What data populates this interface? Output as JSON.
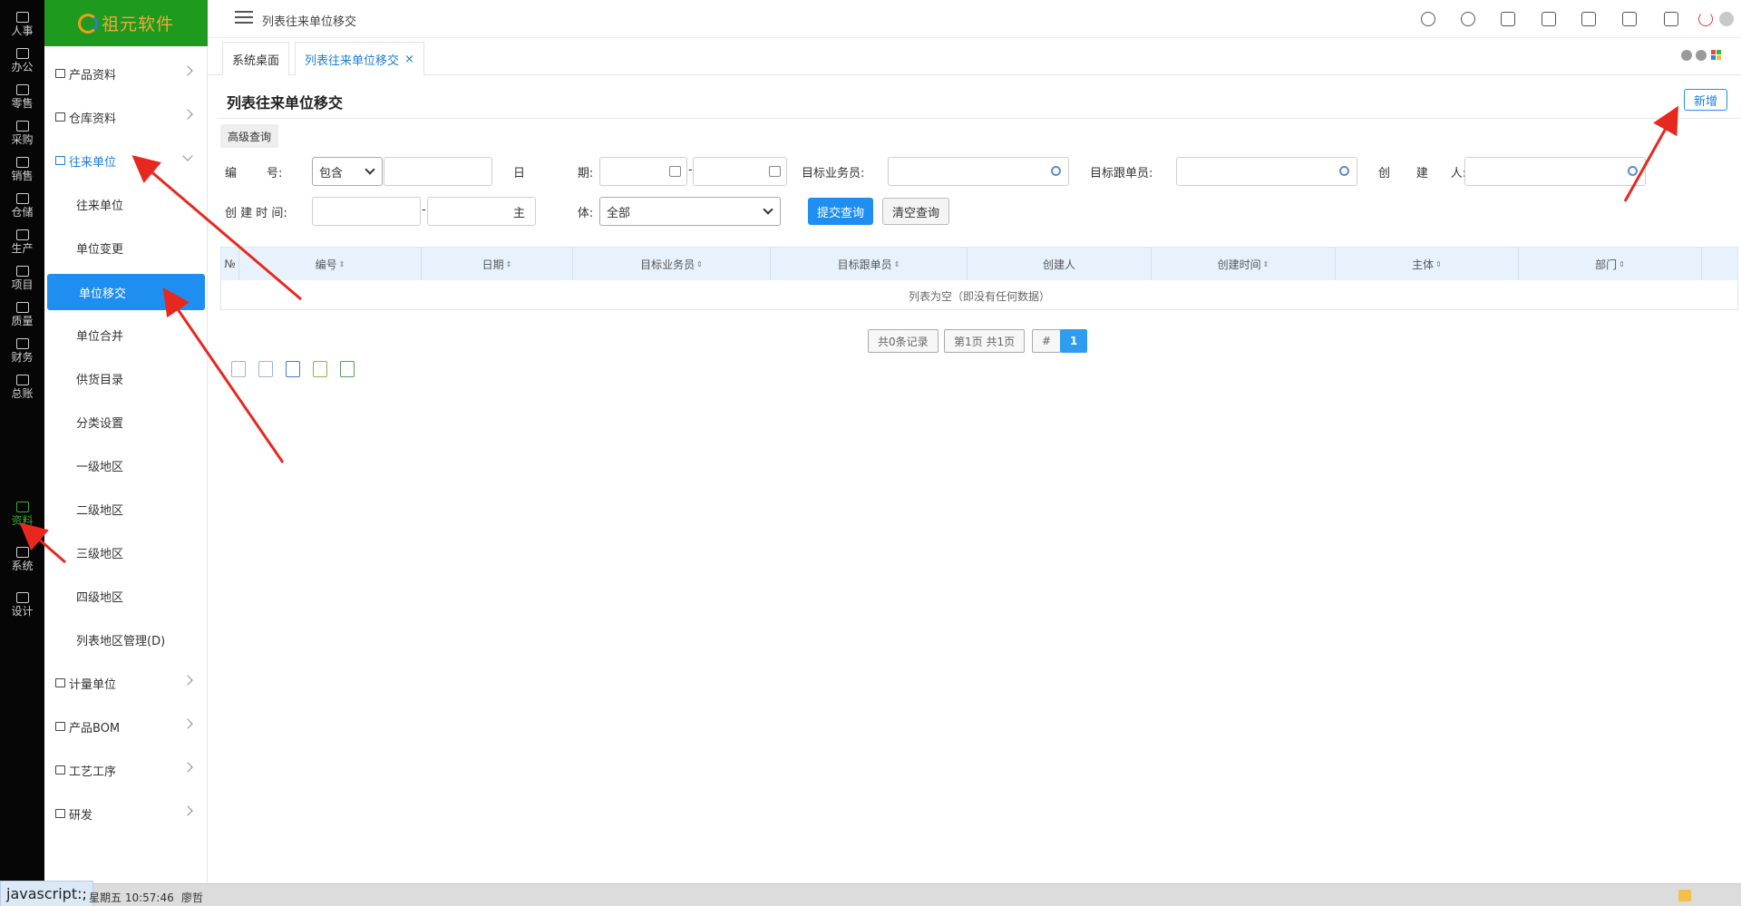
{
  "rail": [
    {
      "label": "人事",
      "icon": "people-icon"
    },
    {
      "label": "办公",
      "icon": "monitor-icon"
    },
    {
      "label": "零售",
      "icon": "store-icon"
    },
    {
      "label": "采购",
      "icon": "truck-icon"
    },
    {
      "label": "销售",
      "icon": "cart-icon"
    },
    {
      "label": "仓储",
      "icon": "boxes-icon"
    },
    {
      "label": "生产",
      "icon": "fingerprint-icon"
    },
    {
      "label": "项目",
      "icon": "layers-icon"
    },
    {
      "label": "质量",
      "icon": "shield-icon"
    },
    {
      "label": "财务",
      "icon": "wallet-icon"
    },
    {
      "label": "总账",
      "icon": "ledger-icon"
    },
    {
      "label": "资料",
      "icon": "document-icon"
    },
    {
      "label": "系统",
      "icon": "gear-icon"
    },
    {
      "label": "设计",
      "icon": "tools-icon"
    }
  ],
  "brand": {
    "name": "祖元软件"
  },
  "menu": {
    "items": [
      {
        "label": "产品资料"
      },
      {
        "label": "仓库资料"
      },
      {
        "label": "往来单位"
      }
    ],
    "sub_items": [
      {
        "label": "往来单位"
      },
      {
        "label": "单位变更"
      },
      {
        "label": "单位移交"
      },
      {
        "label": "单位合并"
      },
      {
        "label": "供货目录"
      },
      {
        "label": "分类设置"
      },
      {
        "label": "一级地区"
      },
      {
        "label": "二级地区"
      },
      {
        "label": "三级地区"
      },
      {
        "label": "四级地区"
      },
      {
        "label": "列表地区管理(D)"
      }
    ],
    "after_items": [
      {
        "label": "计量单位"
      },
      {
        "label": "产品BOM"
      },
      {
        "label": "工艺工序"
      },
      {
        "label": "研发"
      }
    ]
  },
  "topbar": {
    "breadcrumb": "列表往来单位移交"
  },
  "tabs": [
    {
      "label": "系统桌面"
    },
    {
      "label": "列表往来单位移交",
      "close": "×"
    }
  ],
  "page": {
    "title": "列表往来单位移交",
    "new_button": "新增",
    "advanced_query": "高级查询"
  },
  "filters": {
    "code_label": "编        号:",
    "code_match": "包含",
    "date_label": "日              期:",
    "date_sep": "-",
    "salesman_label": "目标业务员:",
    "follower_label": "目标跟单员:",
    "creator_label": "创       建      人:",
    "created_time_label": "创 建 时 间:",
    "created_sep": "-",
    "entity_label": "主              体:",
    "entity_value": "全部",
    "submit": "提交查询",
    "clear": "清空查询"
  },
  "grid": {
    "columns": [
      "№",
      "编号",
      "日期",
      "目标业务员",
      "目标跟单员",
      "创建人",
      "创建时间",
      "主体",
      "部门"
    ],
    "sortable": [
      false,
      true,
      true,
      true,
      true,
      false,
      true,
      true,
      true
    ],
    "sort_glyph": "⇕",
    "empty_text": "列表为空（即没有任何数据）"
  },
  "pager": {
    "total": "共0条记录",
    "pages": "第1页 共1页",
    "hash": "#",
    "current": "1"
  },
  "status": {
    "link_hint": "javascript:;",
    "datetime": "星期五 10:57:46",
    "user": "廖哲"
  },
  "colors": {
    "brand_green": "#1e9a1e",
    "accent_blue": "#1e8ff0",
    "rail_bg": "#060606",
    "annotation_red": "#e8271f"
  }
}
